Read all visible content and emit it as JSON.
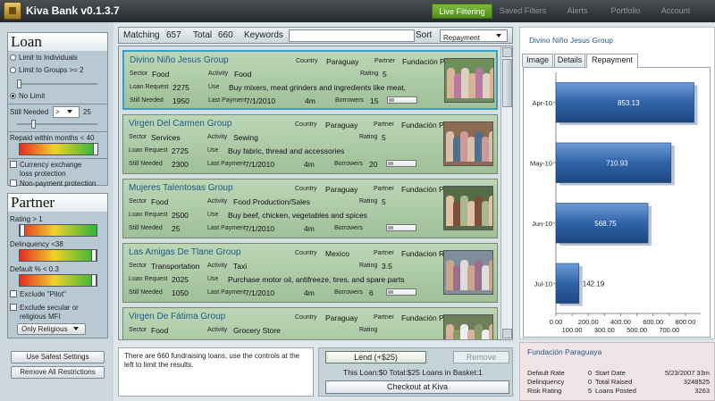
{
  "app": {
    "title": "Kiva Bank v0.1.3.7"
  },
  "nav": {
    "tabs": [
      {
        "label": "Live Filtering",
        "active": true
      },
      {
        "label": "Saved Filters",
        "active": false
      },
      {
        "label": "Alerts",
        "active": false
      },
      {
        "label": "Portfolio",
        "active": false
      },
      {
        "label": "Account",
        "active": false
      }
    ]
  },
  "loan_panel": {
    "title": "Loan",
    "limit_individuals": "Limit to Individuals",
    "limit_groups": "Limit to Groups >= 2",
    "no_limit": "No Limit",
    "selected_radio": "no_limit",
    "still_needed_label": "Still Needed",
    "still_needed_op": ">",
    "still_needed_value": "25",
    "repaid_within": "Repaid within months < 40",
    "currency_protection": "Currency exchange loss protection",
    "currency_line1": "Currency exchange",
    "currency_line2": "loss protection",
    "nonpayment": "Non-payment protection"
  },
  "partner_panel": {
    "title": "Partner",
    "rating": "Rating >  1",
    "delinquency": "Delinquency <38",
    "default": "Default % <    0.3",
    "exclude_pilot": "Exclude \"Pilot\"",
    "exclude_secular_1": "Exclude secular or",
    "exclude_secular_2": "religious MFI",
    "religious_select": "Only Religious"
  },
  "left_buttons": {
    "safest": "Use Safest Settings",
    "remove": "Remove All Restrictions"
  },
  "filterbar": {
    "matching_label": "Matching",
    "matching_value": "657",
    "total_label": "Total",
    "total_value": "660",
    "keywords_label": "Keywords",
    "keywords_value": "",
    "sort_label": "Sort",
    "sort_value": "Repayment"
  },
  "field_labels": {
    "country": "Country",
    "partner": "Partner",
    "sector": "Sector",
    "activity": "Activity",
    "rating": "Rating",
    "loan_request": "Loan Request",
    "use": "Use",
    "still_needed": "Still Needed",
    "last_payment": "Last Payment",
    "borrowers": "Borrowers"
  },
  "loans": [
    {
      "name": "Divino Niño Jesus Group",
      "country": "Paraguay",
      "partner": "Fundación Paraguaya",
      "sector": "Food",
      "activity": "Food",
      "rating": "5",
      "loan_request": "2275",
      "use": "Buy mixers, meat grinders and ingredients like meat,",
      "still_needed": "1950",
      "last_payment": "7/1/2010",
      "term": "4m",
      "borrowers": "15",
      "selected": true
    },
    {
      "name": "Virgen Del Carmen Group",
      "country": "Paraguay",
      "partner": "Fundación Paraguaya",
      "sector": "Services",
      "activity": "Sewing",
      "rating": "5",
      "loan_request": "2725",
      "use": "Buy fabric, thread and accessories",
      "still_needed": "2300",
      "last_payment": "7/1/2010",
      "term": "4m",
      "borrowers": "20",
      "selected": false
    },
    {
      "name": "Mujeres Talentosas Group",
      "country": "Paraguay",
      "partner": "Fundación Paraguaya",
      "sector": "Food",
      "activity": "Food Production/Sales",
      "rating": "5",
      "loan_request": "2500",
      "use": "Buy beef, chicken, vegetables and spices",
      "still_needed": "25",
      "last_payment": "7/1/2010",
      "term": "4m",
      "borrowers": "",
      "selected": false
    },
    {
      "name": "Las Amigas De Tlane Group",
      "country": "Mexico",
      "partner": "Fundacion Realidad A.C",
      "sector": "Transportation",
      "activity": "Taxi",
      "rating": "3.5",
      "loan_request": "2025",
      "use": "Purchase motor oil, antifreeze, tires, and spare parts",
      "still_needed": "1050",
      "last_payment": "7/1/2010",
      "term": "4m",
      "borrowers": "6",
      "selected": false
    },
    {
      "name": "Virgen De Fátima Group",
      "country": "Paraguay",
      "partner": "Fundación Paraguaya",
      "sector": "Food",
      "activity": "Grocery Store",
      "rating": "",
      "loan_request": "",
      "use": "",
      "still_needed": "",
      "last_payment": "",
      "term": "",
      "borrowers": "",
      "selected": false
    }
  ],
  "status_text": "There are 660 fundraising loans, use the controls at the left to limit the results.",
  "basket": {
    "lend_label": "Lend (+$25)",
    "remove_label": "Remove",
    "summary": "This Loan:$0 Total:$25 Loans in Basket:1",
    "checkout_label": "Checkout at Kiva"
  },
  "details": {
    "title": "Divino Niño Jesus Group",
    "tabs": [
      {
        "label": "Image",
        "active": false
      },
      {
        "label": "Details",
        "active": false
      },
      {
        "label": "Repayment",
        "active": true
      }
    ]
  },
  "chart_data": {
    "type": "bar",
    "orientation": "horizontal",
    "categories": [
      "Apr-10",
      "May-10",
      "Jun-10",
      "Jul-10"
    ],
    "values": [
      853.13,
      710.93,
      568.75,
      142.19
    ],
    "value_labels": [
      "853.13",
      "710.93",
      "568.75",
      "142.19"
    ],
    "xlim": [
      0,
      850
    ],
    "xticks": [
      "0.00",
      "100.00",
      "200.00",
      "300.00",
      "400.00",
      "500.00",
      "600.00",
      "700.00",
      "800.00"
    ],
    "xtick_values": [
      0,
      100,
      200,
      300,
      400,
      500,
      600,
      700,
      800
    ],
    "bar_color": "#2f63a8",
    "grid": false
  },
  "partner_summary": {
    "title": "Fundación Paraguaya",
    "default_rate_label": "Default Rate",
    "default_rate": "0",
    "delinquency_label": "Delinquency",
    "delinquency": "0",
    "risk_rating_label": "Risk Rating",
    "risk_rating": "5",
    "start_date_label": "Start Date",
    "start_date": "5/23/2007 33m",
    "total_raised_label": "Total Raised",
    "total_raised": "3248525",
    "loans_posted_label": "Loans Posted",
    "loans_posted": "3263"
  }
}
